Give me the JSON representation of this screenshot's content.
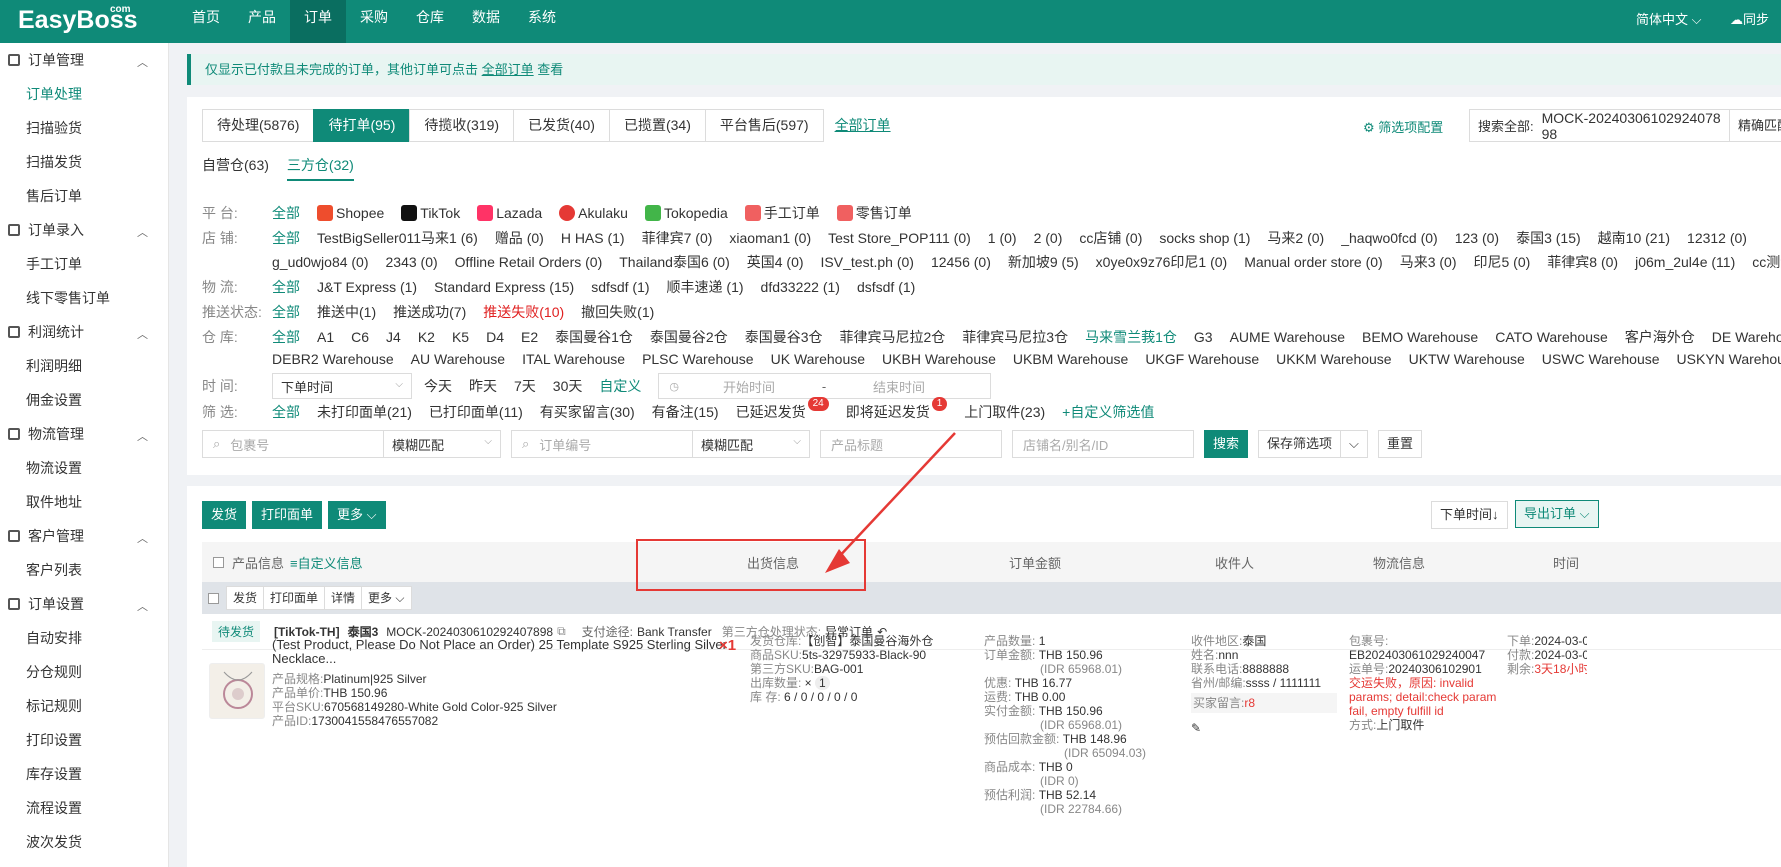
{
  "app": {
    "logo": "EasyBoss",
    "logo_sup": "com",
    "lang": "简体中文",
    "sync": "同步"
  },
  "nav": [
    "首页",
    "产品",
    "订单",
    "采购",
    "仓库",
    "数据",
    "系统"
  ],
  "sidebar": [
    {
      "group": "订单管理",
      "items": [
        "订单处理",
        "扫描验货",
        "扫描发货",
        "售后订单"
      ]
    },
    {
      "group": "订单录入",
      "items": [
        "手工订单",
        "线下零售订单"
      ]
    },
    {
      "group": "利润统计",
      "items": [
        "利润明细",
        "佣金设置"
      ]
    },
    {
      "group": "物流管理",
      "items": [
        "物流设置",
        "取件地址"
      ]
    },
    {
      "group": "客户管理",
      "items": [
        "客户列表"
      ]
    },
    {
      "group": "订单设置",
      "items": [
        "自动安排",
        "分仓规则",
        "标记规则",
        "打印设置",
        "库存设置",
        "流程设置",
        "波次发货"
      ]
    }
  ],
  "notice": {
    "text": "仅显示已付款且未完成的订单，其他订单可点击",
    "link": "全部订单",
    "tail": "查看"
  },
  "tabs": [
    "待处理(5876)",
    "待打单(95)",
    "待揽收(319)",
    "已发货(40)",
    "已揽置(34)",
    "平台售后(597)"
  ],
  "all_orders": "全部订单",
  "filter_config": "筛选项配置",
  "search_all": {
    "label": "搜索全部:",
    "value": "MOCK-20240306102924078​98",
    "exact": "精确匹配"
  },
  "wh_tabs": [
    "自营仓(63)",
    "三方仓(32)"
  ],
  "filters": {
    "platform": {
      "label": "平 台:",
      "items": [
        "全部",
        "Shopee",
        "TikTok",
        "Lazada",
        "Akulaku",
        "Tokopedia",
        "手工订单",
        "零售订单"
      ]
    },
    "shop": {
      "label": "店 铺:",
      "row1": [
        "全部",
        "TestBigSeller011马来1 (6)",
        "赠品 (0)",
        "H HAS (1)",
        "菲律宾7 (0)",
        "xiaoman1 (0)",
        "Test Store_POP111 (0)",
        "1 (0)",
        "2 (0)",
        "cc店铺 (0)",
        "socks shop (1)",
        "马来2 (0)",
        "_haqwo0fcd (0)",
        "123 (0)",
        "泰国3 (15)",
        "越南10 (21)",
        "12312 (0)"
      ],
      "row2": [
        "g_ud0wjo84 (0)",
        "2343 (0)",
        "Offline Retail Orders (0)",
        "Thailand泰国6 (0)",
        "英国4 (0)",
        "ISV_test.ph (0)",
        "12456 (0)",
        "新加坡9 (5)",
        "x0ye0x9z76印尼1 (0)",
        "Manual order store (0)",
        "马来3 (0)",
        "印尼5 (0)",
        "菲律宾8 (0)",
        "j06m_2ul4e (11)",
        "cc测试店铺 (1)"
      ]
    },
    "logistics": {
      "label": "物 流:",
      "items": [
        "全部",
        "J&T Express (1)",
        "Standard Express (15)",
        "sdfsdf (1)",
        "顺丰速递 (1)",
        "dfd33222 (1)",
        "dsfsdf (1)"
      ]
    },
    "push": {
      "label": "推送状态:",
      "items": [
        "全部",
        "推送中(1)",
        "推送成功(7)",
        "推送失败(10)",
        "撤回失败(1)"
      ]
    },
    "warehouse": {
      "label": "仓 库:",
      "row1": [
        "全部",
        "A1",
        "C6",
        "J4",
        "K2",
        "K5",
        "D4",
        "E2",
        "泰国曼谷1仓",
        "泰国曼谷2仓",
        "泰国曼谷3仓",
        "菲律宾马尼拉2仓",
        "菲律宾马尼拉3仓",
        "马来雪兰莪1仓",
        "G3",
        "AUME Warehouse",
        "BEMO Warehouse",
        "CATO Warehouse",
        "客户海外仓",
        "DE Warehouse"
      ],
      "row2": [
        "DEBR2 Warehouse",
        "AU Warehouse",
        "ITAL Warehouse",
        "PLSC Warehouse",
        "UK Warehouse",
        "UKBH Warehouse",
        "UKBM Warehouse",
        "UKGF Warehouse",
        "UKKM Warehouse",
        "UKTW Warehouse",
        "USWC Warehouse",
        "USKYN Warehouse"
      ]
    },
    "time": {
      "label": "时 间:",
      "select": "下单时间",
      "items": [
        "今天",
        "昨天",
        "7天",
        "30天",
        "自定义"
      ],
      "start": "开始时间",
      "sep": "-",
      "end": "结束时间"
    },
    "screen": {
      "label": "筛 选:",
      "items": [
        "全部",
        "未打印面单(21)",
        "已打印面单(11)",
        "有买家留言(30)",
        "有备注(15)",
        "已延迟发货",
        "即将延迟发货",
        "上门取件(23)",
        "+自定义筛选值"
      ],
      "badge_delayed": "24",
      "badge_soon": "1"
    }
  },
  "search_row": {
    "pkg": "包裹号",
    "match1": "模糊匹配",
    "order": "订单编号",
    "match2": "模糊匹配",
    "title": "产品标题",
    "shop": "店铺名/别名/ID",
    "search": "搜索",
    "save": "保存筛选项",
    "reset": "重置"
  },
  "toolbar": {
    "ship": "发货",
    "print": "打印面单",
    "more": "更多",
    "sort": "下单时间↓",
    "export": "导出订单"
  },
  "thead": {
    "product": "产品信息",
    "custom": "≡自定义信息",
    "ship": "出货信息",
    "amount": "订单金额",
    "recv": "收件人",
    "logi": "物流信息",
    "time": "时间"
  },
  "subhead": {
    "ship": "发货",
    "print": "打印面单",
    "detail": "详情",
    "more": "更多"
  },
  "order": {
    "status": "待发货",
    "platform": "[TikTok-TH]",
    "shop": "泰国3",
    "id": "MOCK-20240306102924078​98",
    "pay_label": "支付途径:",
    "pay": "Bank Transfer",
    "third_label": "第三方仓处理状态:",
    "third": "异常订单",
    "product": {
      "title": "(Test Product, Please Do Not Place an Order) 25 Template S925 Sterling Silver Necklace...",
      "qty": "×1",
      "spec": "产品规格:",
      "spec_v": "Platinum|925 Silver",
      "price": "产品单价:",
      "price_v": "THB 150.96",
      "psku": "平台SKU:",
      "psku_v": "670568149280-White Gold Color-925 Silver",
      "pid": "产品ID:",
      "pid_v": "1730041558476557082"
    },
    "ship": {
      "wh": "发货仓库:",
      "wh_v": "【创智】泰国曼谷海外仓",
      "sku": "商品SKU:",
      "sku_v": "5ts-32975933-Black-90",
      "tsku": "第三方SKU:",
      "tsku_v": "BAG-001",
      "outqty": "出库数量:",
      "outqty_v": "1",
      "stock": "库 存:",
      "stock_v": "6 / 0 / 0 / 0 / 0"
    },
    "amount": [
      [
        "产品数量:",
        "1",
        ""
      ],
      [
        "订单金额:",
        "THB 150.96",
        "(IDR 65968.01)"
      ],
      [
        "优惠:",
        "THB 16.77",
        ""
      ],
      [
        "运费:",
        "THB 0.00",
        ""
      ],
      [
        "实付金额:",
        "THB 150.96",
        "(IDR 65968.01)"
      ],
      [
        "预估回款金额:",
        "THB 148.96",
        "(IDR 65094.03)"
      ],
      [
        "商品成本:",
        "THB 0",
        "(IDR 0)"
      ],
      [
        "预估利润:",
        "THB 52.14",
        "(IDR 22784.66)"
      ]
    ],
    "recv": {
      "area": "收件地区:",
      "area_v": "泰国",
      "name": "姓名:",
      "name_v": "nnn",
      "phone": "联系电话:",
      "phone_v": "8888888",
      "prov": "省州/邮编:",
      "prov_v": "ssss / 1111111",
      "msg": "买家留言:",
      "msg_v": "r8"
    },
    "logi": {
      "pkg": "包裹号:",
      "pkg_v": "EB202403061029240047",
      "way": "运单号:",
      "way_v": "20240306102901",
      "err": "交运失败，原因: invalid params; detail:check param fail, empty fulfill id",
      "method": "方式:",
      "method_v": "上门取件"
    },
    "time": {
      "order": "下单:",
      "order_v": "2024-03-0",
      "pay": "付款:",
      "pay_v": "2024-03-0",
      "left": "剩余:",
      "left_v": "3天18小时"
    }
  }
}
